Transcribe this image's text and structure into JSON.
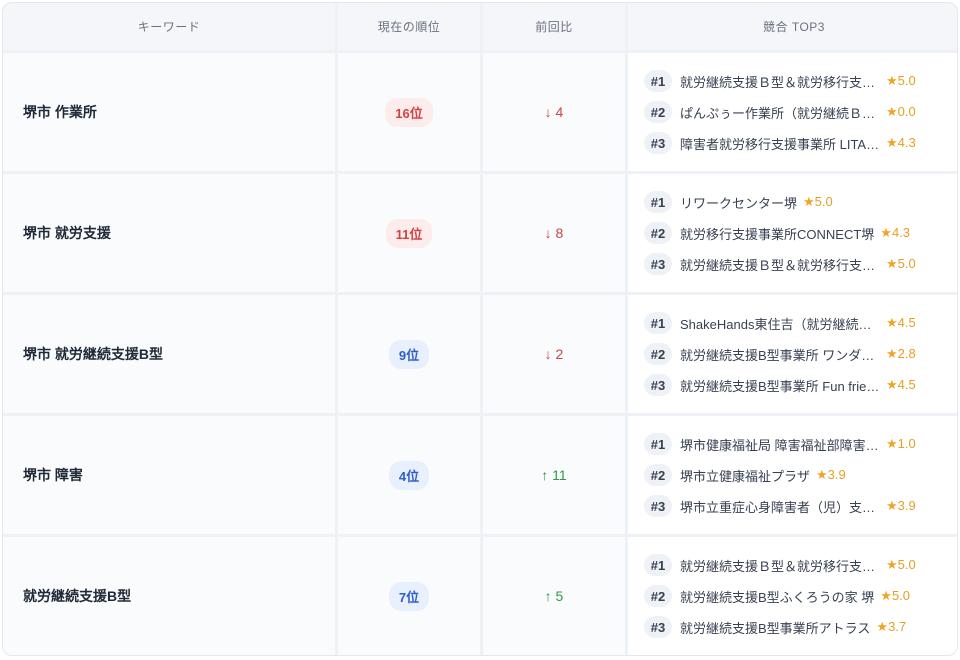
{
  "header": {
    "keyword": "キーワード",
    "current_rank": "現在の順位",
    "change": "前回比",
    "competitors": "競合 TOP3"
  },
  "colors": {
    "rank_bad": "#d14343",
    "rank_good": "#2f5fc4",
    "up": "#2f9a4b",
    "down": "#d14343",
    "star": "#f0a422"
  },
  "rows": [
    {
      "keyword": "堺市 作業所",
      "rank": "16位",
      "rank_status": "bad",
      "change": "↓ 4",
      "direction": "down",
      "competitors": [
        {
          "pos": "#1",
          "name": "就労継続支援Ｂ型＆就労移行支援事業所",
          "rating": "5.0"
        },
        {
          "pos": "#2",
          "name": "ぱんぷぅー作業所（就労継続Ｂ型）",
          "rating": "0.0"
        },
        {
          "pos": "#3",
          "name": "障害者就労移行支援事業所 LITALICO",
          "rating": "4.3"
        }
      ]
    },
    {
      "keyword": "堺市 就労支援",
      "rank": "11位",
      "rank_status": "bad",
      "change": "↓ 8",
      "direction": "down",
      "competitors": [
        {
          "pos": "#1",
          "name": "リワークセンター堺",
          "rating": "5.0"
        },
        {
          "pos": "#2",
          "name": "就労移行支援事業所CONNECT堺",
          "rating": "4.3"
        },
        {
          "pos": "#3",
          "name": "就労継続支援Ｂ型＆就労移行支援事業所",
          "rating": "5.0"
        }
      ]
    },
    {
      "keyword": "堺市 就労継続支援B型",
      "rank": "9位",
      "rank_status": "good",
      "change": "↓ 2",
      "direction": "down",
      "competitors": [
        {
          "pos": "#1",
          "name": "ShakeHands東住吉（就労継続支援）",
          "rating": "4.5"
        },
        {
          "pos": "#2",
          "name": "就労継続支援B型事業所 ワンダフル",
          "rating": "2.8"
        },
        {
          "pos": "#3",
          "name": "就労継続支援B型事業所 Fun friends",
          "rating": "4.5"
        }
      ]
    },
    {
      "keyword": "堺市 障害",
      "rank": "4位",
      "rank_status": "good",
      "change": "↑ 11",
      "direction": "up",
      "competitors": [
        {
          "pos": "#1",
          "name": "堺市健康福祉局 障害福祉部障害施策推進課",
          "rating": "1.0"
        },
        {
          "pos": "#2",
          "name": "堺市立健康福祉プラザ",
          "rating": "3.9"
        },
        {
          "pos": "#3",
          "name": "堺市立重症心身障害者（児）支援センター",
          "rating": "3.9"
        }
      ]
    },
    {
      "keyword": "就労継続支援B型",
      "rank": "7位",
      "rank_status": "good",
      "change": "↑ 5",
      "direction": "up",
      "competitors": [
        {
          "pos": "#1",
          "name": "就労継続支援Ｂ型＆就労移行支援事業所",
          "rating": "5.0"
        },
        {
          "pos": "#2",
          "name": "就労継続支援B型ふくろうの家 堺",
          "rating": "5.0"
        },
        {
          "pos": "#3",
          "name": "就労継続支援B型事業所アトラス",
          "rating": "3.7"
        }
      ]
    }
  ]
}
